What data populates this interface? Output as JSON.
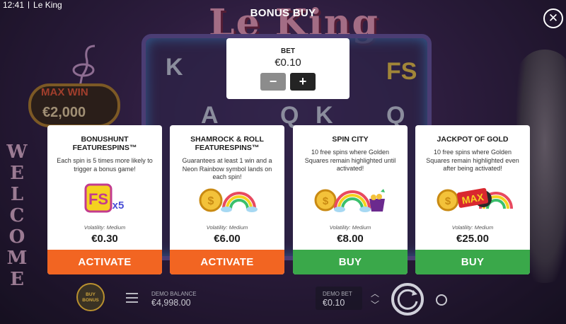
{
  "status_bar": {
    "time": "12:41",
    "app_name": "Le King"
  },
  "background": {
    "logo": "Le King",
    "max_win_label": "MAX WIN",
    "max_win_value": "€2,000",
    "welcome_text": "WELCOME",
    "reel_symbols": [
      "K",
      "A",
      "Q",
      "K",
      "Q",
      "FS"
    ]
  },
  "dialog": {
    "title": "BONUS BUY",
    "close_icon": "close-icon"
  },
  "bet": {
    "label": "BET",
    "value": "€0.10",
    "minus_label": "−",
    "plus_label": "+"
  },
  "cards": [
    {
      "title": "BONUSHUNT FEATURESPINS™",
      "description": "Each spin is 5 times more likely to trigger a bonus game!",
      "image": "fs-x5-badge",
      "image_text": "FS",
      "image_multiplier": "x5",
      "volatility": "Volatility: Medium",
      "price": "€0.30",
      "action": "ACTIVATE",
      "action_color": "#f26522"
    },
    {
      "title": "SHAMROCK & ROLL FEATURESPINS™",
      "description": "Guarantees at least 1 win and a Neon Rainbow symbol lands on each spin!",
      "image": "coin-rainbow",
      "volatility": "Volatility: Medium",
      "price": "€6.00",
      "action": "ACTIVATE",
      "action_color": "#f26522"
    },
    {
      "title": "SPIN CITY",
      "description": "10 free spins where Golden Squares remain highlighted until activated!",
      "image": "coin-rainbow-pot",
      "volatility": "Volatility: Medium",
      "price": "€8.00",
      "action": "BUY",
      "action_color": "#3aa84a"
    },
    {
      "title": "JACKPOT OF GOLD",
      "description": "10 free spins where Golden Squares remain highlighted even after being activated!",
      "image": "coin-max-rainbow",
      "image_text": "MAX",
      "volatility": "Volatility: Medium",
      "price": "€25.00",
      "action": "BUY",
      "action_color": "#3aa84a"
    }
  ],
  "bottom_bar": {
    "buy_bonus_label": "BUY BONUS",
    "balance_label": "DEMO BALANCE",
    "balance_value": "€4,998.00",
    "demo_bet_label": "DEMO BET",
    "demo_bet_value": "€0.10",
    "increase_icon": "chevron-up-icon",
    "decrease_icon": "chevron-down-icon",
    "spin_icon": "spin-icon",
    "autoplay_icon": "autoplay-icon",
    "menu_icon": "menu-icon"
  }
}
